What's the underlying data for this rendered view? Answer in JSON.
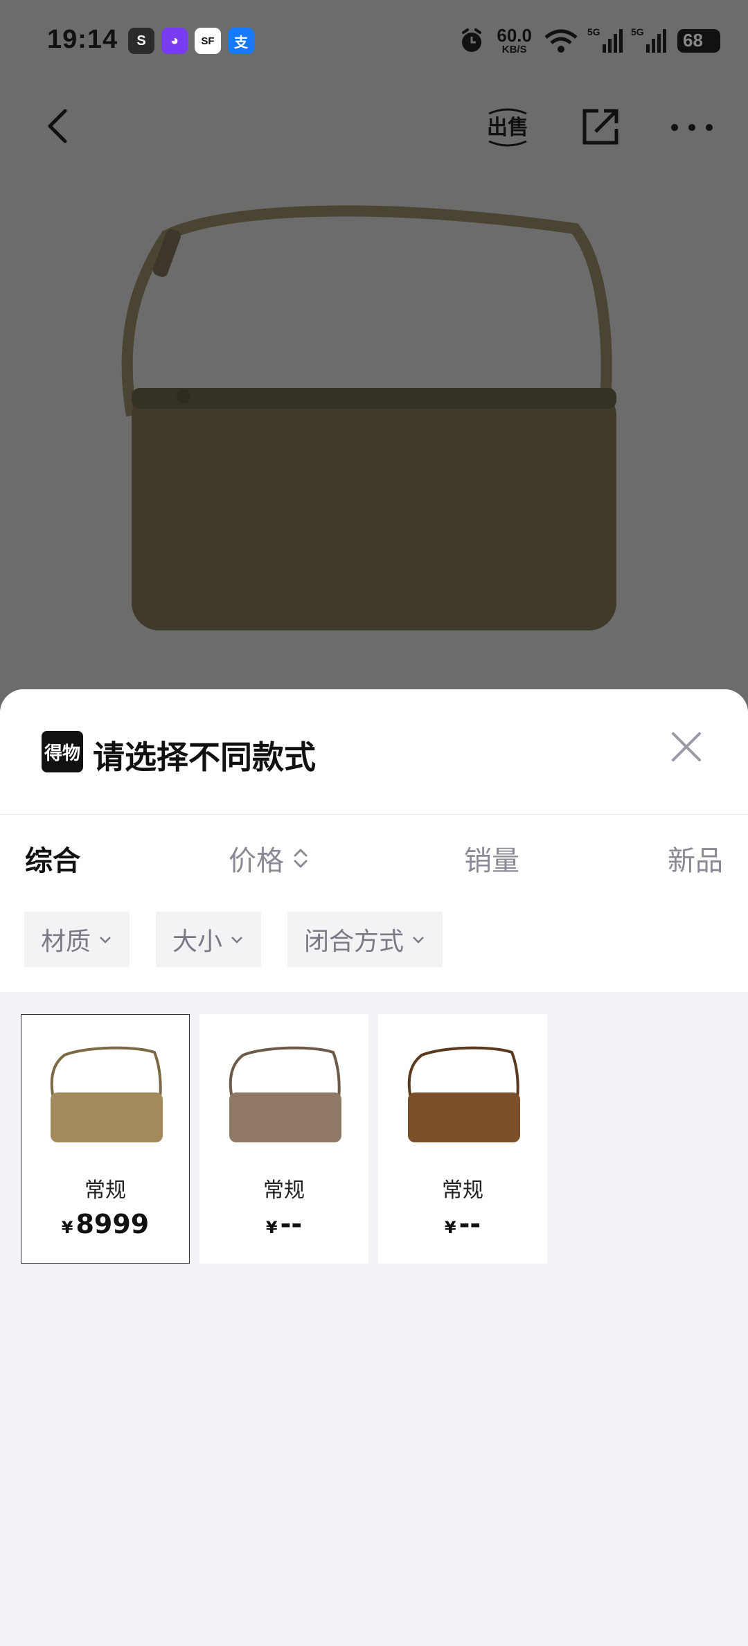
{
  "status_bar": {
    "time": "19:14",
    "app_icons": [
      {
        "name": "dewu-app-icon",
        "glyph": "S",
        "color": "#2b2b2b"
      },
      {
        "name": "cat-app-icon",
        "glyph": "◕",
        "color": "#7a3cf0"
      },
      {
        "name": "sf-express-icon",
        "glyph": "SF",
        "color": "#ffffff"
      },
      {
        "name": "alipay-icon",
        "glyph": "支",
        "color": "#1677ff"
      }
    ],
    "net_speed_value": "60.0",
    "net_speed_unit": "KB/S",
    "signal_label_1": "5G",
    "signal_label_2": "5G",
    "battery": "68"
  },
  "nav": {
    "sell_label": "出售"
  },
  "sheet": {
    "logo_text": "得物",
    "title": "请选择不同款式"
  },
  "sort": {
    "items": [
      {
        "label": "综合",
        "active": true
      },
      {
        "label": "价格"
      },
      {
        "label": "销量"
      },
      {
        "label": "新品"
      }
    ]
  },
  "filters": [
    {
      "label": "材质"
    },
    {
      "label": "大小"
    },
    {
      "label": "闭合方式"
    }
  ],
  "products": [
    {
      "name": "常规",
      "currency": "¥",
      "price": "8999",
      "selected": true,
      "color": "#a38a5c"
    },
    {
      "name": "常规",
      "currency": "¥",
      "price": "--",
      "selected": false,
      "color": "#8f7866"
    },
    {
      "name": "常规",
      "currency": "¥",
      "price": "--",
      "selected": false,
      "color": "#7a4f2a"
    }
  ],
  "colors": {
    "overlay_bg": "#6c6c6c",
    "hero_bag": "#3f3a2a",
    "sheet_bg": "#f3f3f7"
  }
}
